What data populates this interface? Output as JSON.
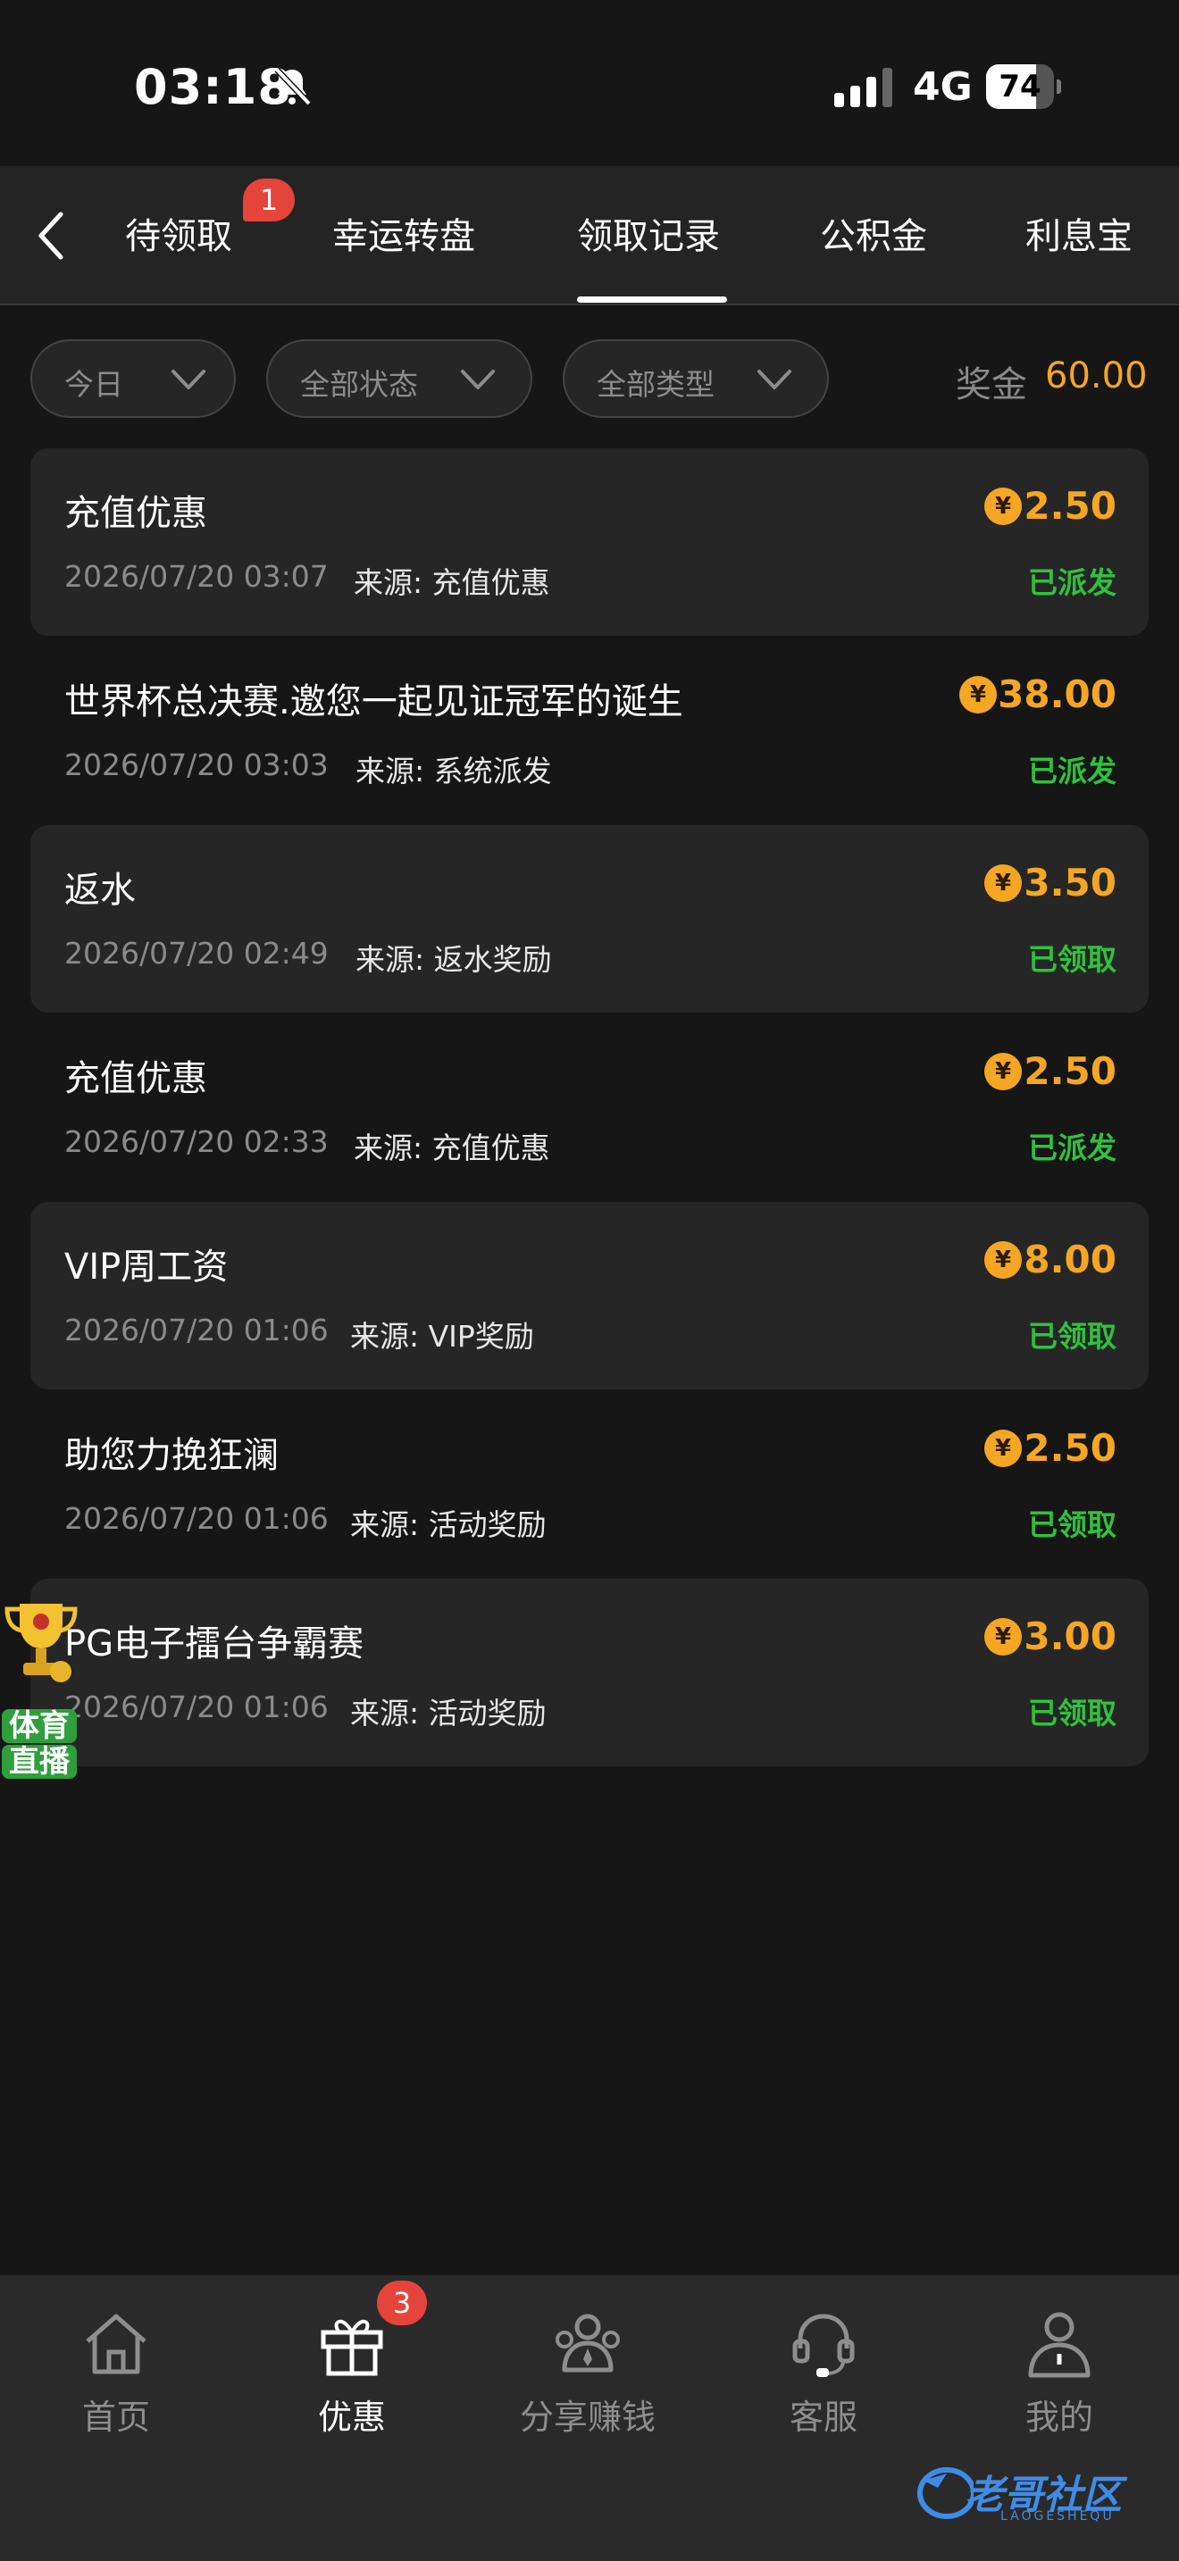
{
  "status_bar": {
    "time": "03:18",
    "network": "4G",
    "battery": "74",
    "battery_level": 0.74
  },
  "tabs": [
    {
      "label": "待领取",
      "badge": "1"
    },
    {
      "label": "幸运转盘"
    },
    {
      "label": "领取记录",
      "active": true
    },
    {
      "label": "公积金"
    },
    {
      "label": "利息宝"
    }
  ],
  "filters": {
    "date": "今日",
    "status": "全部状态",
    "type": "全部类型"
  },
  "bonus": {
    "label": "奖金",
    "value": "60.00"
  },
  "currency_symbol": "¥",
  "records": [
    {
      "title": "充值优惠",
      "time": "2026/07/20 03:07",
      "source": "来源: 充值优惠",
      "amount": "2.50",
      "status": "已派发"
    },
    {
      "title": "世界杯总决赛.邀您一起见证冠军的诞生",
      "time": "2026/07/20 03:03",
      "source": "来源: 系统派发",
      "amount": "38.00",
      "status": "已派发"
    },
    {
      "title": "返水",
      "time": "2026/07/20 02:49",
      "source": "来源: 返水奖励",
      "amount": "3.50",
      "status": "已领取"
    },
    {
      "title": "充值优惠",
      "time": "2026/07/20 02:33",
      "source": "来源: 充值优惠",
      "amount": "2.50",
      "status": "已派发"
    },
    {
      "title": "VIP周工资",
      "time": "2026/07/20 01:06",
      "source": "来源: VIP奖励",
      "amount": "8.00",
      "status": "已领取"
    },
    {
      "title": "助您力挽狂澜",
      "time": "2026/07/20 01:06",
      "source": "来源: 活动奖励",
      "amount": "2.50",
      "status": "已领取"
    },
    {
      "title": "PG电子擂台争霸赛",
      "time": "2026/07/20 01:06",
      "source": "来源: 活动奖励",
      "amount": "3.00",
      "status": "已领取"
    }
  ],
  "float_widget": {
    "line1": "体育",
    "line2": "直播"
  },
  "bottom_nav": [
    {
      "label": "首页",
      "icon": "home-icon"
    },
    {
      "label": "优惠",
      "icon": "gift-icon",
      "badge": "3",
      "active": true
    },
    {
      "label": "分享赚钱",
      "icon": "share-earn-icon"
    },
    {
      "label": "客服",
      "icon": "headset-icon"
    },
    {
      "label": "我的",
      "icon": "profile-icon"
    }
  ],
  "watermark": {
    "text": "老哥社区",
    "sub": "LAOGESHEQU"
  },
  "colors": {
    "accent": "#f5a623",
    "success": "#2fc23d",
    "badge": "#e5443b",
    "background": "#161616"
  }
}
